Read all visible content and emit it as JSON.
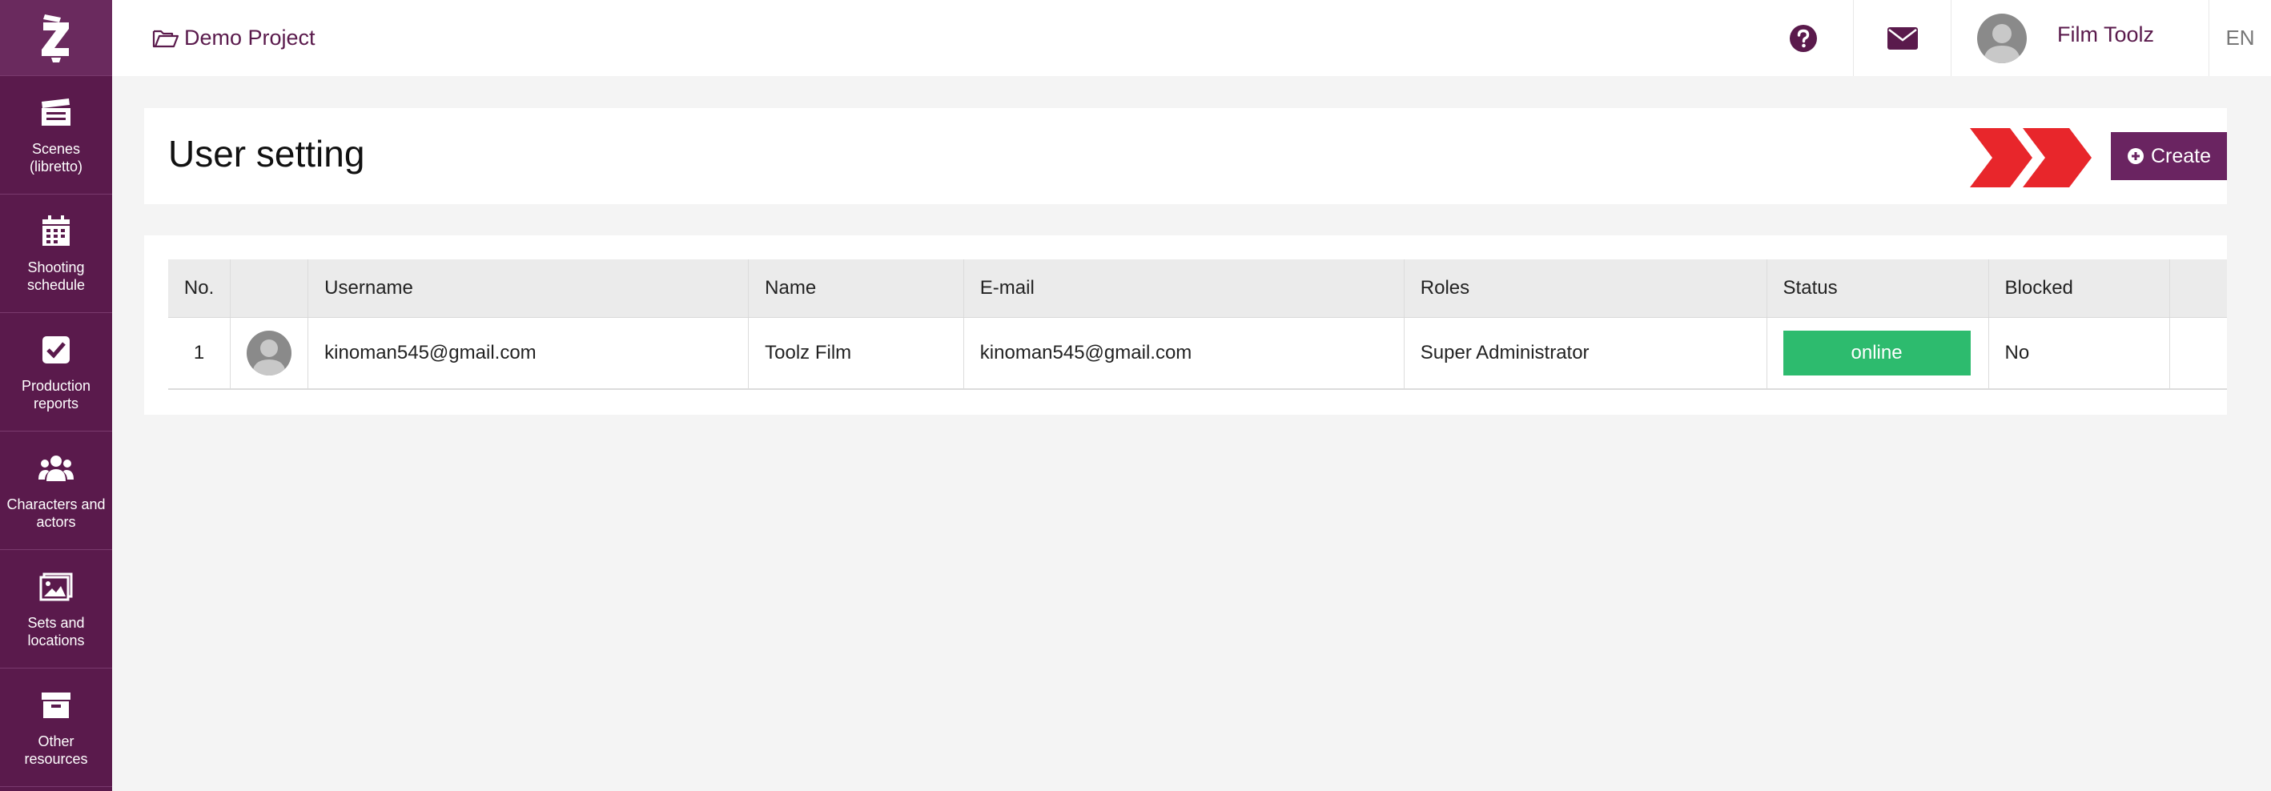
{
  "sidebar": {
    "items": [
      {
        "label": "Scenes (libretto)",
        "icon": "clapperboard-icon"
      },
      {
        "label": "Shooting schedule",
        "icon": "calendar-icon"
      },
      {
        "label": "Production reports",
        "icon": "checkbox-icon"
      },
      {
        "label": "Characters and actors",
        "icon": "users-icon"
      },
      {
        "label": "Sets and locations",
        "icon": "image-icon"
      },
      {
        "label": "Other resources",
        "icon": "archive-box-icon"
      }
    ]
  },
  "topbar": {
    "project": "Demo Project",
    "user_name": "Film Toolz",
    "language": "EN"
  },
  "header": {
    "title": "User setting",
    "create_label": "Create"
  },
  "table": {
    "columns": [
      "No.",
      "",
      "Username",
      "Name",
      "E-mail",
      "Roles",
      "Status",
      "Blocked",
      ""
    ],
    "rows": [
      {
        "no": "1",
        "username": "kinoman545@gmail.com",
        "name": "Toolz Film",
        "email": "kinoman545@gmail.com",
        "role": "Super Administrator",
        "status": "online",
        "blocked": "No"
      }
    ]
  },
  "colors": {
    "brand": "#5a1a4c",
    "status_online": "#2dbb6e",
    "chevron": "#e8262b"
  }
}
